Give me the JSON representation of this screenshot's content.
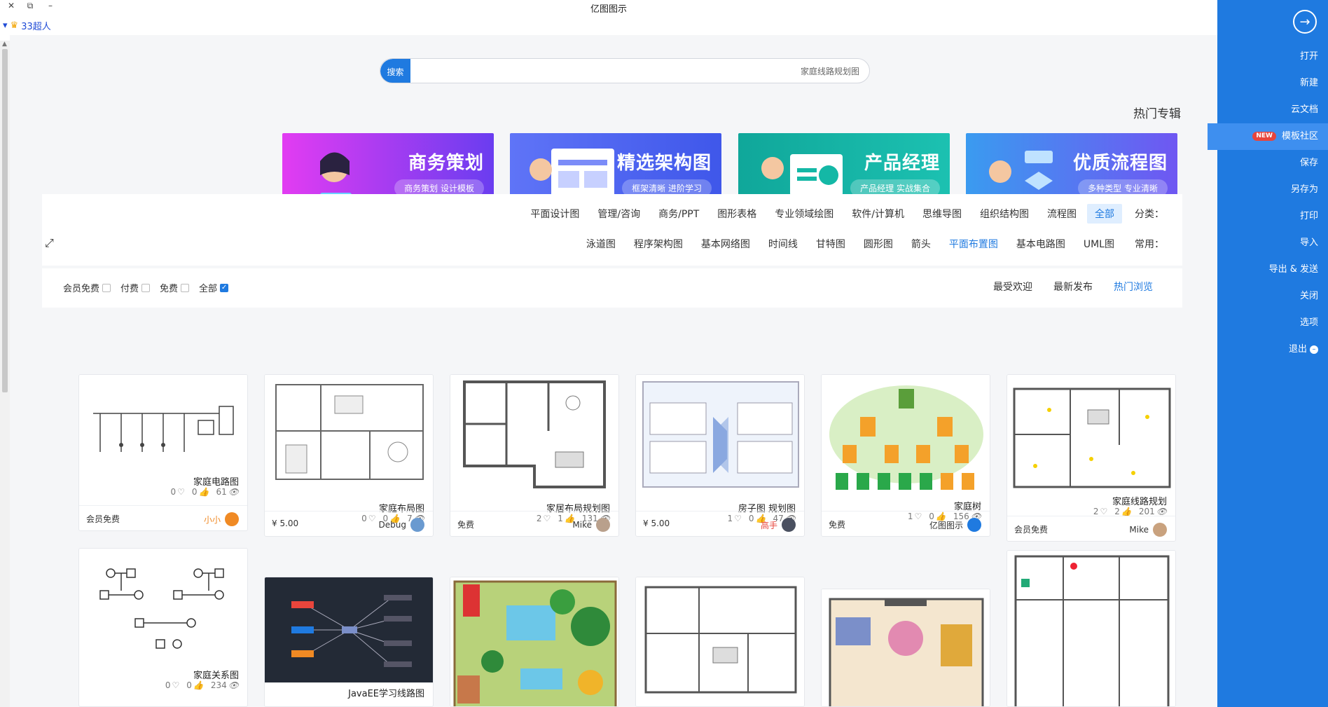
{
  "window": {
    "title": "亿图图示",
    "close": "✕",
    "restore": "⧉",
    "minimize": "–"
  },
  "user": {
    "name": "33超人",
    "dropdown": "▾"
  },
  "search": {
    "button": "搜索",
    "value": "家庭线路规划图"
  },
  "section_title": "热门专辑",
  "banners": [
    {
      "title": "优质流程图",
      "subtitle": "多种类型 专业清晰",
      "color": "#3a7bf0"
    },
    {
      "title": "产品经理",
      "subtitle": "产品经理 实战集合",
      "color": "#14b8a6"
    },
    {
      "title": "精选架构图",
      "subtitle": "框架清晰 进阶学习",
      "color": "#4f6df5"
    },
    {
      "title": "商务策划",
      "subtitle": "商务策划 设计模板",
      "color": "#8b3df0"
    }
  ],
  "filters": {
    "category_label": "分类：",
    "categories": [
      "全部",
      "流程图",
      "组织结构图",
      "思维导图",
      "软件/计算机",
      "专业领域绘图",
      "图形表格",
      "商务/PPT",
      "管理/咨询",
      "平面设计图"
    ],
    "common_label": "常用：",
    "common": [
      "UML图",
      "基本电路图",
      "平面布置图",
      "箭头",
      "圆形图",
      "甘特图",
      "时间线",
      "基本网络图",
      "程序架构图",
      "泳道图"
    ],
    "expand": "⤢"
  },
  "sort": {
    "options": [
      "热门浏览",
      "最新发布",
      "最受欢迎"
    ]
  },
  "price_filter": [
    {
      "label": "全部",
      "checked": true
    },
    {
      "label": "免费",
      "checked": false
    },
    {
      "label": "付费",
      "checked": false
    },
    {
      "label": "会员免费",
      "checked": false
    }
  ],
  "cards": [
    {
      "name": "家庭线路规划",
      "views": "201",
      "likes": "2",
      "favs": "2",
      "author": "Mike",
      "price": "会员免费"
    },
    {
      "name": "家庭树",
      "views": "156",
      "likes": "0",
      "favs": "1",
      "author": "亿图图示",
      "price": "免费"
    },
    {
      "name": "房子图 规划图",
      "views": "47",
      "likes": "0",
      "favs": "1",
      "author": "高手",
      "price": "¥ 5.00"
    },
    {
      "name": "家居布局规划图",
      "views": "131",
      "likes": "1",
      "favs": "2",
      "author": "Mike",
      "price": "免费"
    },
    {
      "name": "家庭布局图",
      "views": "7",
      "likes": "0",
      "favs": "0",
      "author": "Debug",
      "price": "¥ 5.00"
    },
    {
      "name": "家庭电路图",
      "views": "61",
      "likes": "0",
      "favs": "0",
      "author": "小小",
      "price": "会员免费"
    },
    {
      "name": "家庭关系图",
      "views": "234",
      "likes": "0",
      "favs": "0"
    },
    {
      "name": "JavaEE学习线路图"
    }
  ],
  "sidebar": {
    "back": "→",
    "items": [
      {
        "label": "打开"
      },
      {
        "label": "新建"
      },
      {
        "label": "云文档"
      },
      {
        "label": "模板社区",
        "badge": "NEW"
      },
      {
        "label": "保存"
      },
      {
        "label": "另存为"
      },
      {
        "label": "打印"
      },
      {
        "label": "导入"
      },
      {
        "label": "导出 & 发送"
      },
      {
        "label": "关闭"
      },
      {
        "label": "选项"
      },
      {
        "label": "退出"
      }
    ]
  },
  "colors": {
    "accent": "#1f7ae0",
    "sidebar": "#1f7ae0",
    "badge": "#e8453c"
  },
  "icons": {
    "eye": "👁",
    "like": "👍",
    "fav": "♡"
  }
}
